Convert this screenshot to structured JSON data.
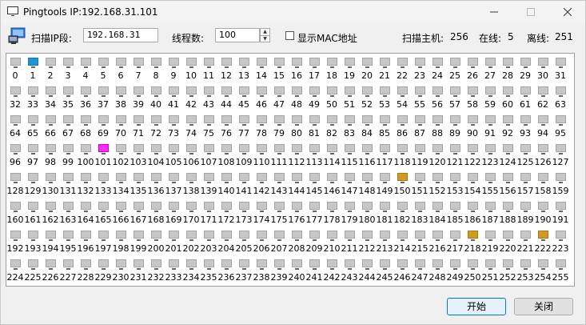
{
  "window": {
    "title": "Pingtools  IP:192.168.31.101"
  },
  "toolbar": {
    "ip_label": "扫描IP段:",
    "ip_value": "192.168.31",
    "thread_label": "线程数:",
    "thread_value": "100",
    "show_mac_label": "显示MAC地址",
    "show_mac_checked": false,
    "scan_hosts_label": "扫描主机:",
    "scan_hosts_value": "256",
    "online_label": "在线:",
    "online_value": "5",
    "offline_label": "离线:",
    "offline_value": "251"
  },
  "hosts": {
    "count": 256,
    "start": 0,
    "online": [
      1
    ],
    "magenta": [
      101
    ],
    "orange": [
      150,
      218,
      222
    ],
    "colors": {
      "online": "#1f95d4",
      "magenta": "#ff2aff",
      "orange": "#d49a20",
      "offline": "#c7c7c7"
    }
  },
  "buttons": {
    "start_label": "开始",
    "close_label": "关闭"
  }
}
